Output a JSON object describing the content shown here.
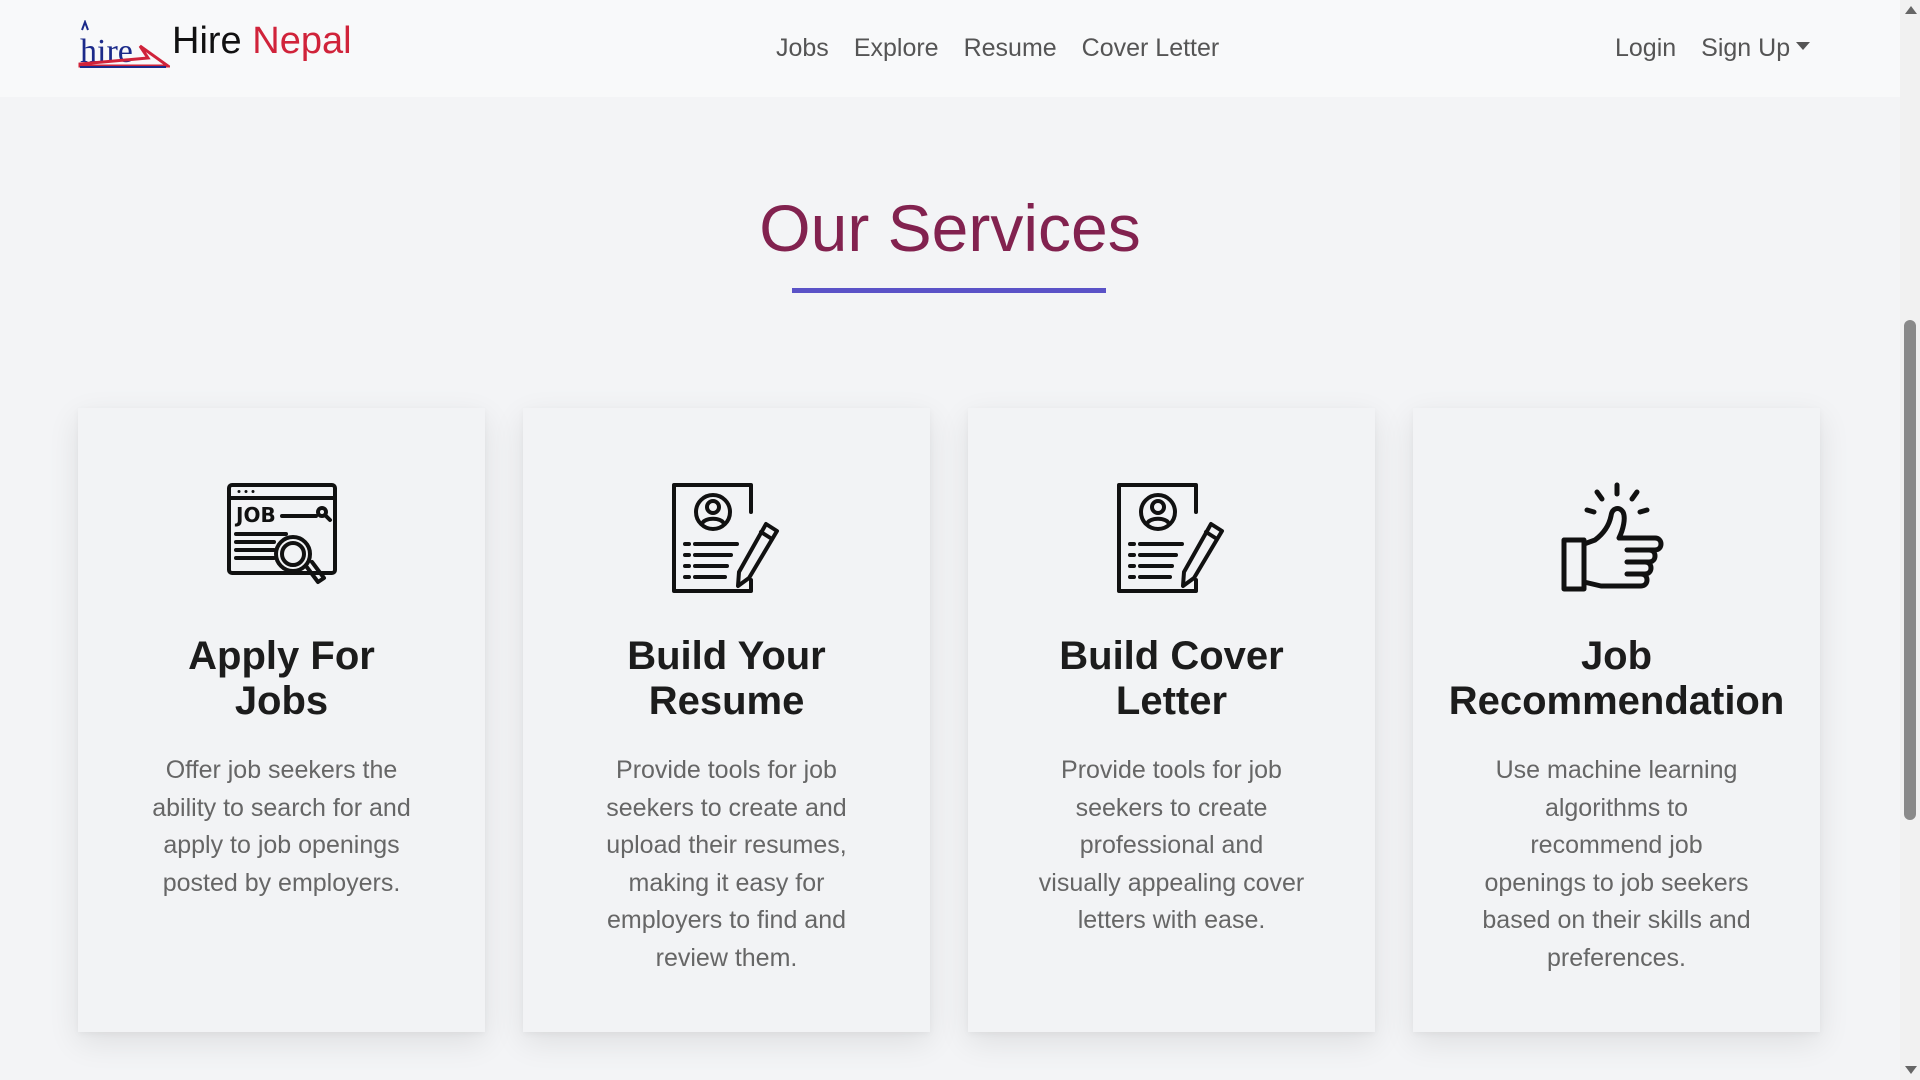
{
  "brand": {
    "hire": "Hire",
    "nepal": "Nepal",
    "logo_text": "hire"
  },
  "nav": {
    "center": [
      "Jobs",
      "Explore",
      "Resume",
      "Cover Letter"
    ],
    "login": "Login",
    "signup": "Sign Up"
  },
  "section": {
    "title": "Our Services"
  },
  "cards": [
    {
      "icon": "job-search-icon",
      "title_line1": "Apply For",
      "title_line2": "Jobs",
      "description": "Offer job seekers the ability to search for and apply to job openings posted by employers."
    },
    {
      "icon": "resume-edit-icon",
      "title_line1": "Build Your",
      "title_line2": "Resume",
      "description": "Provide tools for job seekers to create and upload their resumes, making it easy for employers to find and review them."
    },
    {
      "icon": "cover-letter-edit-icon",
      "title_line1": "Build Cover",
      "title_line2": "Letter",
      "description": "Provide tools for job seekers to create professional and visually appealing cover letters with ease."
    },
    {
      "icon": "thumbs-up-icon",
      "title_line1": "Job",
      "title_line2": "Recommendation",
      "description": "Use machine learning algorithms to recommend job openings to job seekers based on their skills and preferences."
    }
  ],
  "colors": {
    "title": "#82224f",
    "underline": "#5a52c7",
    "brand_accent": "#d0233a",
    "background": "#f3f4f6"
  }
}
